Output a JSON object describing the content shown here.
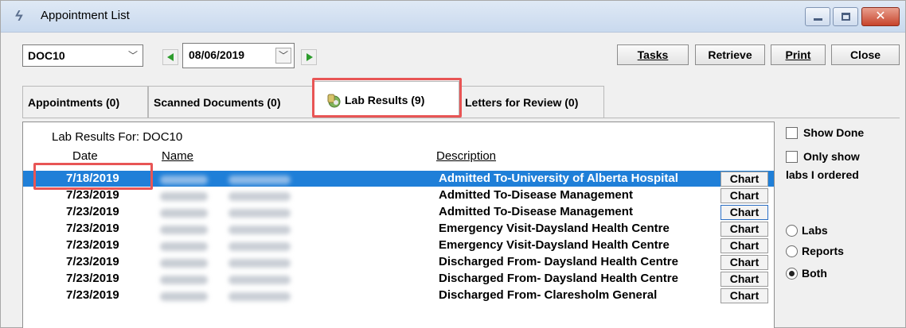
{
  "window": {
    "title": "Appointment List",
    "minimize_label": "",
    "maximize_label": "",
    "close_label": "✕"
  },
  "toolbar": {
    "doctor_value": "DOC10",
    "date_value": "08/06/2019",
    "tasks_label": "Tasks",
    "retrieve_label": "Retrieve",
    "print_label": "Print",
    "close_label": "Close"
  },
  "tabs": [
    {
      "label": "Appointments (0)"
    },
    {
      "label": "Scanned Documents (0)"
    },
    {
      "label": "Lab Results (9)"
    },
    {
      "label": "Letters for Review (0)"
    }
  ],
  "list": {
    "caption": "Lab Results For: DOC10",
    "headers": {
      "date": "Date",
      "name": "Name",
      "description": "Description"
    },
    "chart_label": "Chart",
    "rows": [
      {
        "date": "7/18/2019",
        "description": "Admitted To-University of Alberta Hospital",
        "selected": true
      },
      {
        "date": "7/23/2019",
        "description": "Admitted To-Disease Management"
      },
      {
        "date": "7/23/2019",
        "description": "Admitted To-Disease Management"
      },
      {
        "date": "7/23/2019",
        "description": "Emergency Visit-Daysland Health Centre"
      },
      {
        "date": "7/23/2019",
        "description": "Emergency Visit-Daysland Health Centre"
      },
      {
        "date": "7/23/2019",
        "description": "Discharged From- Daysland Health Centre"
      },
      {
        "date": "7/23/2019",
        "description": "Discharged From- Daysland Health Centre"
      },
      {
        "date": "7/23/2019",
        "description": "Discharged From- Claresholm General"
      }
    ]
  },
  "options": {
    "show_done": "Show Done",
    "only_show_line1": "Only show",
    "only_show_line2": "labs I ordered",
    "radio_labs": "Labs",
    "radio_reports": "Reports",
    "radio_both": "Both",
    "selected_radio": "Both"
  },
  "colors": {
    "selection": "#1f7fd8",
    "highlight_box": "#e85555",
    "nav_arrow": "#2d9c2d"
  }
}
